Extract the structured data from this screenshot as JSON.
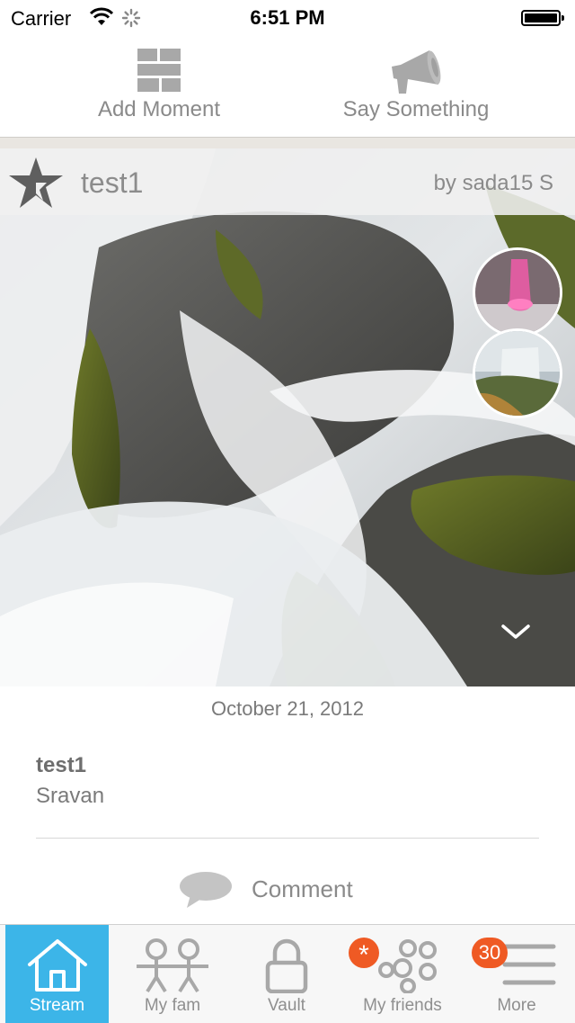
{
  "status_bar": {
    "carrier": "Carrier",
    "time": "6:51 PM"
  },
  "actions": {
    "add_moment": "Add Moment",
    "say_something": "Say Something"
  },
  "moment": {
    "title": "test1",
    "author": "by sada15 S",
    "date": "October 21, 2012",
    "detail_title": "test1",
    "detail_subtitle": "Sravan",
    "comment_label": "Comment"
  },
  "tabs": [
    {
      "label": "Stream",
      "icon": "home-icon",
      "active": true
    },
    {
      "label": "My fam",
      "icon": "family-icon"
    },
    {
      "label": "Vault",
      "icon": "lock-icon"
    },
    {
      "label": "My friends",
      "icon": "friends-icon",
      "badge": "*"
    },
    {
      "label": "More",
      "icon": "menu-icon",
      "badge": "30"
    }
  ],
  "colors": {
    "accent": "#3cb5e8",
    "badge": "#ef5a24",
    "icon_gray": "#a8a8a8"
  }
}
